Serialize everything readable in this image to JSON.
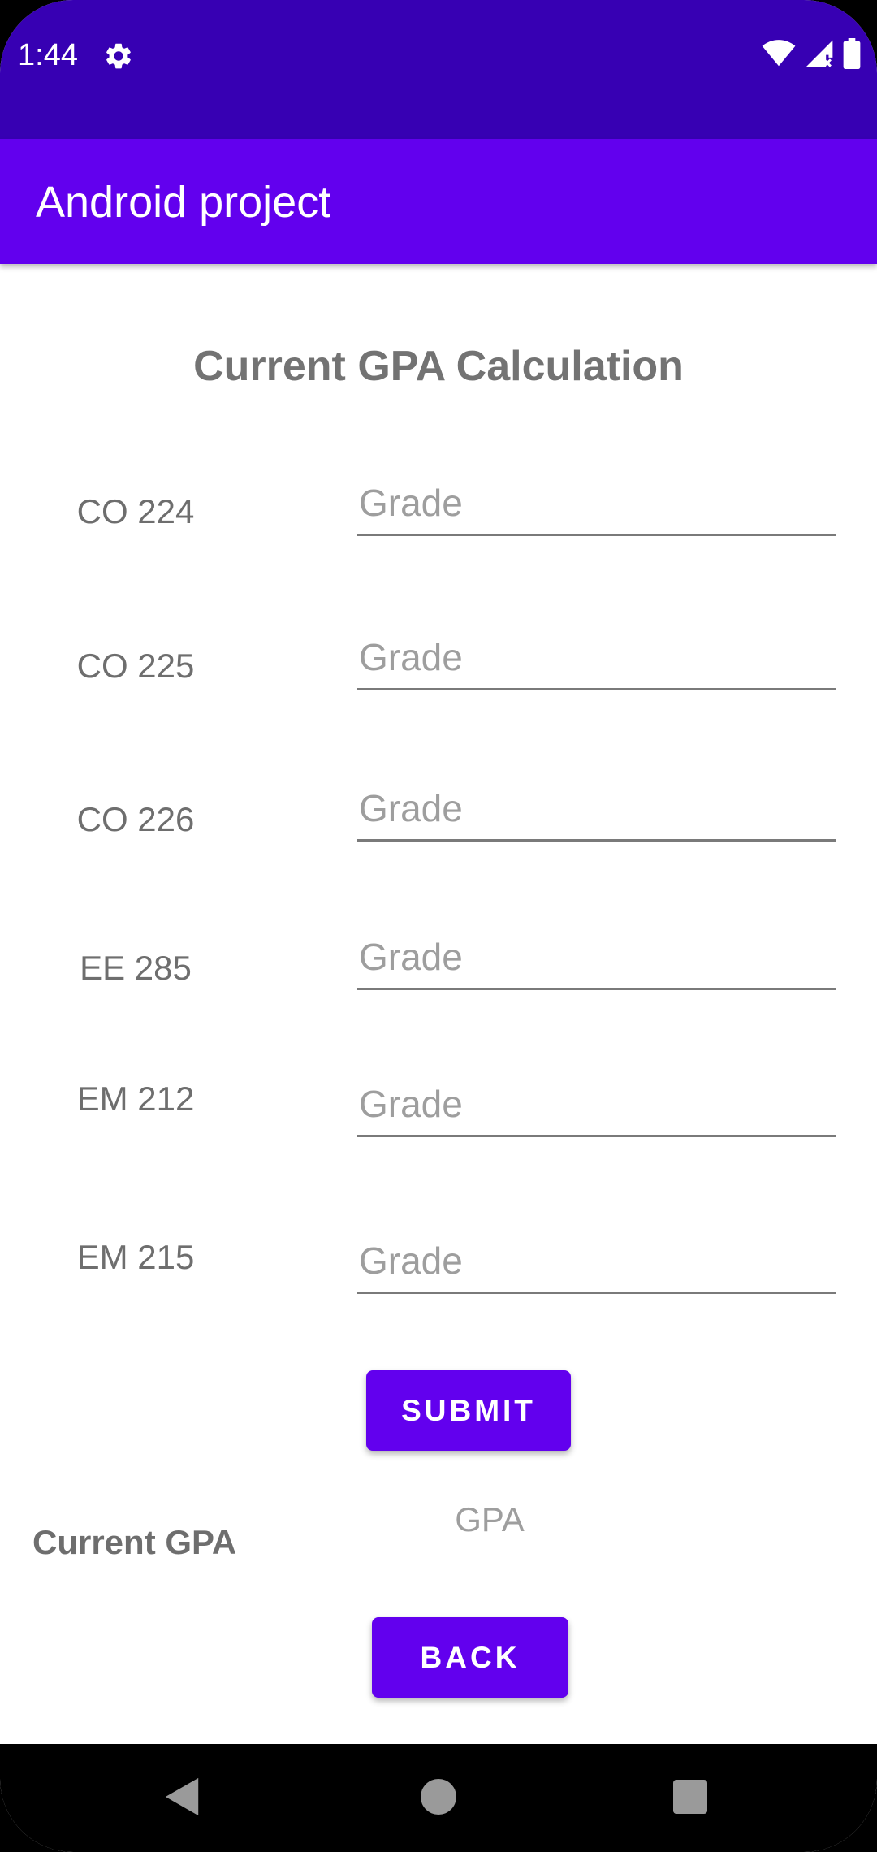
{
  "status_bar": {
    "time": "1:44",
    "icons": [
      "gear-icon",
      "wifi-icon",
      "signal-icon",
      "battery-icon"
    ]
  },
  "app_bar": {
    "title": "Android project"
  },
  "main": {
    "heading": "Current GPA Calculation",
    "courses": [
      {
        "code": "CO 224",
        "placeholder": "Grade",
        "value": ""
      },
      {
        "code": "CO 225",
        "placeholder": "Grade",
        "value": ""
      },
      {
        "code": "CO 226",
        "placeholder": "Grade",
        "value": ""
      },
      {
        "code": "EE 285",
        "placeholder": "Grade",
        "value": ""
      },
      {
        "code": "EM 212",
        "placeholder": "Grade",
        "value": ""
      },
      {
        "code": "EM 215",
        "placeholder": "Grade",
        "value": ""
      }
    ],
    "submit_label": "SUBMIT",
    "gpa_label": "Current GPA",
    "gpa_value": "GPA",
    "back_label": "BACK"
  },
  "nav_bar": {
    "icons": [
      "back-triangle-icon",
      "home-circle-icon",
      "recents-square-icon"
    ]
  },
  "colors": {
    "status_bar": "#3700b3",
    "primary": "#6200ee",
    "label_text": "#6e6e6e",
    "hint_text": "#9e9e9e"
  }
}
